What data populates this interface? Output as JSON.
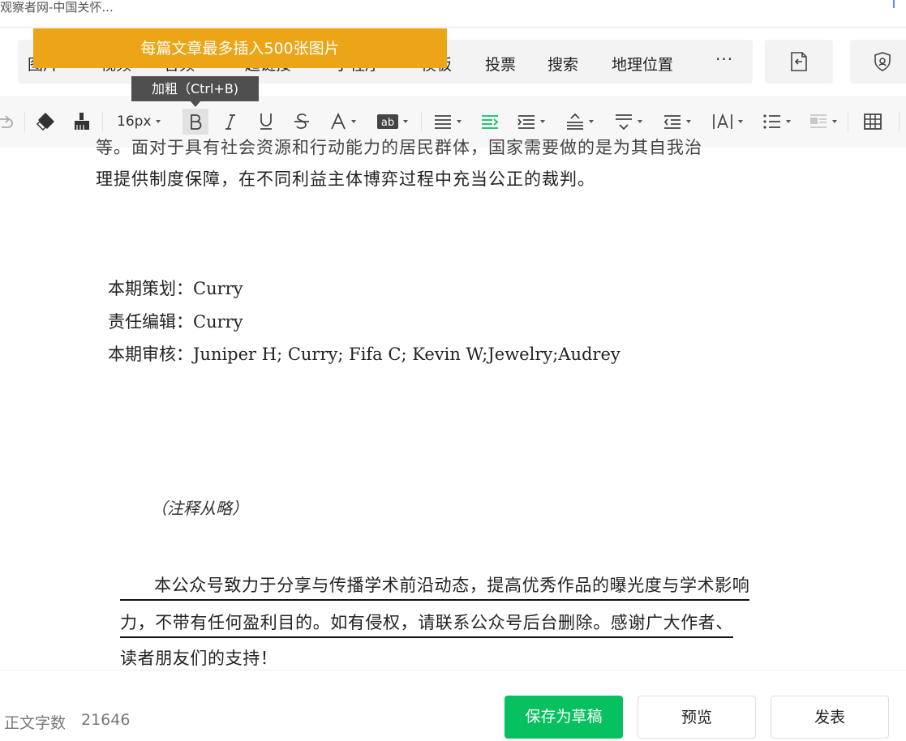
{
  "page": {
    "title": "观察者网-中国关怀..."
  },
  "banner": {
    "text": "每篇文章最多插入500张图片"
  },
  "tooltip": {
    "text": "加粗（Ctrl+B)"
  },
  "menu": {
    "items": [
      {
        "label": "图片"
      },
      {
        "label": "视频"
      },
      {
        "label": "音频"
      },
      {
        "label": "超链接"
      },
      {
        "label": "小程序"
      },
      {
        "label": "模板"
      },
      {
        "label": "投票"
      },
      {
        "label": "搜索"
      },
      {
        "label": "地理位置"
      }
    ],
    "more": "···"
  },
  "toolbar": {
    "font_size": "16px"
  },
  "content": {
    "partial_line": "等。面对于具有社会资源和行动能力的居民群体，国家需要做的是为其自我治",
    "para_line2": "理提供制度保障，在不同利益主体博弈过程中充当公正的裁判。",
    "credits": [
      {
        "label": "本期策划：",
        "value": "Curry"
      },
      {
        "label": "责任编辑：",
        "value": "Curry"
      },
      {
        "label": "本期审核：",
        "value": "Juniper H; Curry; Fifa C; Kevin W;Jewelry;Audrey"
      }
    ],
    "note": "（注释从略）",
    "disclaimer": [
      "本公众号致力于分享与传播学术前沿动态，提高优秀作品的曝光度与学术影响",
      "力，不带有任何盈利目的。如有侵权，请联系公众号后台删除。感谢广大作者、",
      "读者朋友们的支持！"
    ]
  },
  "footer": {
    "word_count_label": "正文字数",
    "word_count": "21646",
    "save_draft": "保存为草稿",
    "preview": "预览",
    "publish": "发表"
  },
  "colors": {
    "accent_green": "#07c160",
    "banner_orange": "#eba517",
    "tooltip_bg": "#4f4f4f"
  }
}
